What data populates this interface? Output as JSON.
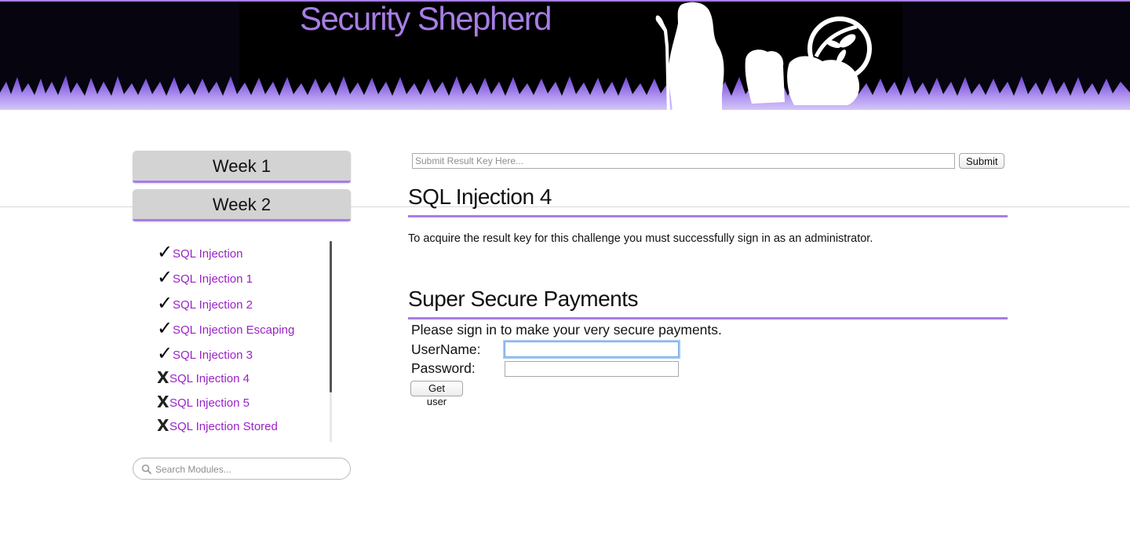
{
  "header": {
    "site_title": "Security Shepherd",
    "logo_icon": "owasp-wasp-icon",
    "colors": {
      "accent": "#a77de6",
      "banner_bg": "#05040f"
    }
  },
  "sidebar": {
    "tabs": [
      {
        "label": "Week 1"
      },
      {
        "label": "Week 2"
      }
    ],
    "modules": [
      {
        "label": "SQL Injection",
        "status": "completed",
        "mark": "✓"
      },
      {
        "label": "SQL Injection 1",
        "status": "completed",
        "mark": "✓"
      },
      {
        "label": "SQL Injection 2",
        "status": "completed",
        "mark": "✓"
      },
      {
        "label": "SQL Injection Escaping",
        "status": "completed",
        "mark": "✓"
      },
      {
        "label": "SQL Injection 3",
        "status": "completed",
        "mark": "✓"
      },
      {
        "label": "SQL Injection 4",
        "status": "incomplete",
        "mark": "X"
      },
      {
        "label": "SQL Injection 5",
        "status": "incomplete",
        "mark": "X"
      },
      {
        "label": "SQL Injection Stored",
        "status": "incomplete",
        "mark": "X"
      }
    ],
    "search": {
      "placeholder": "Search Modules...",
      "value": ""
    }
  },
  "main": {
    "result_key": {
      "placeholder": "Submit Result Key Here...",
      "value": ""
    },
    "submit_label": "Submit",
    "challenge_title": "SQL Injection 4",
    "challenge_description": "To acquire the result key for this challenge you must successfully sign in as an administrator.",
    "app": {
      "title": "Super Secure Payments",
      "intro": "Please sign in to make your very secure payments.",
      "username_label": "UserName:",
      "password_label": "Password:",
      "username_value": "",
      "password_value": "",
      "button_label": "Get user"
    }
  }
}
